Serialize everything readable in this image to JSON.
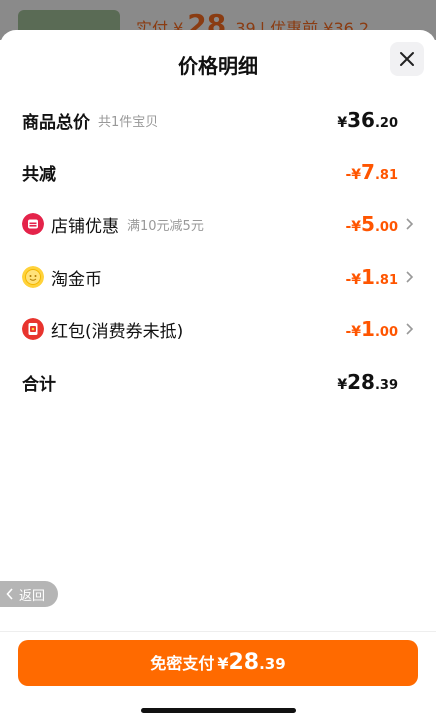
{
  "background": {
    "summary_prefix": "实付 ¥",
    "summary_int": "28",
    "summary_dec": ".39",
    "summary_suffix": "| 优惠前 ¥36.2"
  },
  "sheet": {
    "title": "价格明细",
    "close_icon": "close-icon"
  },
  "rows": {
    "total": {
      "label": "商品总价",
      "sub": "共1件宝贝",
      "sym": "¥",
      "int": "36",
      "dec": ".20"
    },
    "reduce": {
      "label": "共减",
      "sym": "-¥",
      "int": "7",
      "dec": ".81"
    },
    "store": {
      "label": "店铺优惠",
      "sub": "满10元减5元",
      "sym": "-¥",
      "int": "5",
      "dec": ".00",
      "icon": "store-coupon-icon"
    },
    "coin": {
      "label": "淘金币",
      "sym": "-¥",
      "int": "1",
      "dec": ".81",
      "icon": "gold-coin-icon"
    },
    "redpacket": {
      "label": "红包(消费券未抵)",
      "sym": "-¥",
      "int": "1",
      "dec": ".00",
      "icon": "red-packet-icon"
    },
    "sum": {
      "label": "合计",
      "sym": "¥",
      "int": "28",
      "dec": ".39"
    }
  },
  "back": {
    "label": "返回"
  },
  "pay": {
    "label": "免密支付",
    "sym": "¥",
    "int": "28",
    "dec": ".39"
  },
  "colors": {
    "accent": "#ff6a00",
    "discount": "#ff5500"
  }
}
